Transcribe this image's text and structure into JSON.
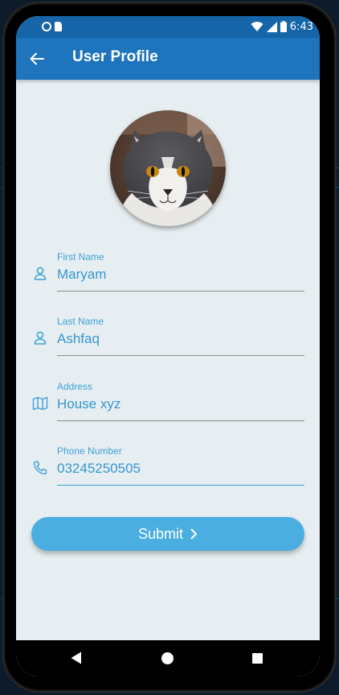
{
  "status_bar": {
    "time": "6:43"
  },
  "app_bar": {
    "title": "User Profile"
  },
  "profile": {
    "avatar": "cat-photo"
  },
  "fields": [
    {
      "label": "First Name",
      "value": "Maryam",
      "icon": "person-icon"
    },
    {
      "label": "Last Name",
      "value": "Ashfaq",
      "icon": "person-icon"
    },
    {
      "label": "Address",
      "value": "House xyz",
      "icon": "map-icon"
    },
    {
      "label": "Phone Number",
      "value": "03245250505",
      "icon": "phone-icon"
    }
  ],
  "submit": {
    "label": "Submit",
    "icon": "chevron-right-icon"
  },
  "colors": {
    "app_bar": "#1e74bd",
    "status_bar": "#1565a8",
    "accent": "#3ea0d6",
    "button": "#4aaee0",
    "background": "#e7eef2"
  }
}
